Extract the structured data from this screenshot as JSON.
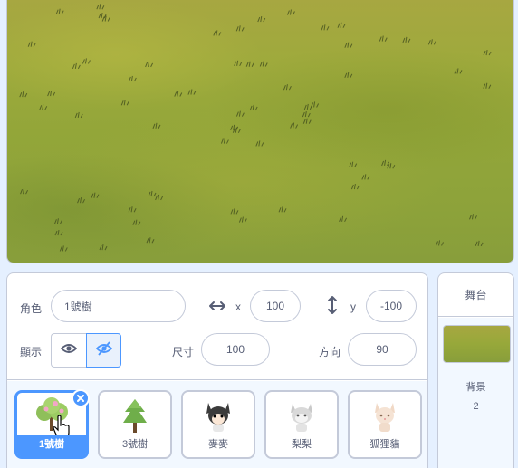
{
  "sprite_info": {
    "sprite_label": "角色",
    "sprite_name": "1號樹",
    "x_label": "x",
    "x_value": "100",
    "y_label": "y",
    "y_value": "-100",
    "show_label": "顯示",
    "size_label": "尺寸",
    "size_value": "100",
    "direction_label": "方向",
    "direction_value": "90"
  },
  "sprites": [
    {
      "name": "1號樹",
      "icon": "tree-icon",
      "selected": true
    },
    {
      "name": "3號樹",
      "icon": "tree-icon",
      "selected": false
    },
    {
      "name": "麥麥",
      "icon": "dog-icon",
      "selected": false
    },
    {
      "name": "梨梨",
      "icon": "cat-icon",
      "selected": false
    },
    {
      "name": "狐狸貓",
      "icon": "fox-cat-icon",
      "selected": false
    }
  ],
  "stage_selector": {
    "title": "舞台",
    "backdrops_label": "背景",
    "backdrops_count": "2"
  },
  "colors": {
    "accent": "#4c97ff",
    "grass": "#93a639",
    "panel_bg": "#e5f0ff"
  }
}
